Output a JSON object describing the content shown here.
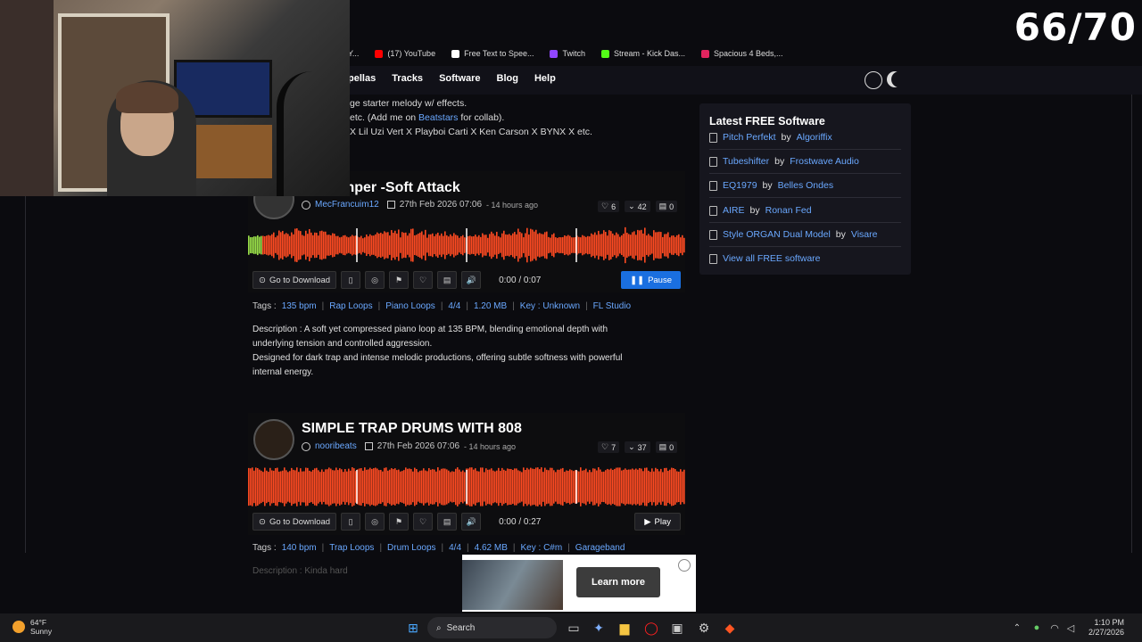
{
  "overlay": {
    "counter": "66/70"
  },
  "bookmarks": [
    {
      "label": "Y...",
      "color": "#888888"
    },
    {
      "label": "(17) YouTube",
      "color": "#ff0000"
    },
    {
      "label": "Free Text to Spee...",
      "color": "#ffffff"
    },
    {
      "label": "Twitch",
      "color": "#9146ff"
    },
    {
      "label": "Stream - Kick Das...",
      "color": "#53fc18"
    },
    {
      "label": "Spacious 4 Beds,...",
      "color": "#e0245e"
    }
  ],
  "nav": {
    "items": [
      "pellas",
      "Tracks",
      "Software",
      "Blog",
      "Help"
    ]
  },
  "prev_post": {
    "line1": "ge starter melody w/ effects.",
    "line2_pre": "etc. (Add me on ",
    "line2_link": "Beatstars",
    "line2_post": " for collab).",
    "line3": "X Lil Uzi Vert X Playboi Carti X Ken Carson X BYNX X etc."
  },
  "cards": [
    {
      "title": "mper -Soft Attack",
      "author": "MecFrancuim12",
      "date": "27th Feb 2026 07:06",
      "ago": "- 14 hours ago",
      "likes": "6",
      "downloads": "42",
      "comments": "0",
      "download_label": "Go to Download",
      "time": "0:00 / 0:07",
      "play_label": "Pause",
      "play_color": "#1a6fe0",
      "tags_label": "Tags :",
      "tags": [
        "135 bpm",
        "Rap Loops",
        "Piano Loops",
        "4/4",
        "1.20 MB",
        "Key : Unknown",
        "FL Studio"
      ],
      "desc_lines": [
        "Description : A soft yet compressed piano loop at 135 BPM, blending emotional depth with",
        "underlying tension and controlled aggression.",
        "Designed for dark trap and intense melodic productions, offering subtle softness with powerful",
        "internal energy."
      ],
      "progress": 0.01
    },
    {
      "title": "SIMPLE TRAP DRUMS WITH 808",
      "author": "nooribeats",
      "date": "27th Feb 2026 07:06",
      "ago": "- 14 hours ago",
      "likes": "7",
      "downloads": "37",
      "comments": "0",
      "download_label": "Go to Download",
      "time": "0:00 / 0:27",
      "play_label": "Play",
      "play_color": "#1d1d22",
      "tags_label": "Tags :",
      "tags": [
        "140 bpm",
        "Trap Loops",
        "Drum Loops",
        "4/4",
        "4.62 MB",
        "Key : C#m",
        "Garageband"
      ],
      "desc_lines": [
        "Description : Kinda hard"
      ],
      "progress": 0
    }
  ],
  "sidebar": {
    "title": "Latest FREE Software",
    "by": "by",
    "items": [
      {
        "name": "Pitch Perfekt",
        "maker": "Algoriffix"
      },
      {
        "name": "Tubeshifter",
        "maker": "Frostwave Audio"
      },
      {
        "name": "EQ1979",
        "maker": "Belles Ondes"
      },
      {
        "name": "AIRE",
        "maker": "Ronan Fed"
      },
      {
        "name": "Style ORGAN Dual Model",
        "maker": "Visare"
      }
    ],
    "view_all": "View all FREE software"
  },
  "ad": {
    "cta": "Learn more"
  },
  "taskbar": {
    "search": "Search",
    "weather_temp": "64°F",
    "weather_cond": "Sunny",
    "time": "1:10 PM",
    "date": "2/27/2026"
  },
  "colors": {
    "wave": "#ff4a22",
    "link": "#6aa8ff",
    "accent": "#1a6fe0"
  }
}
